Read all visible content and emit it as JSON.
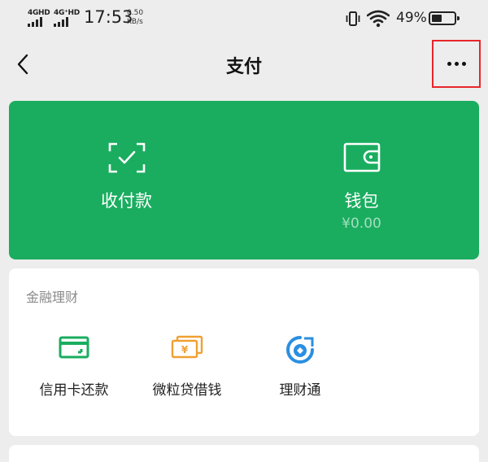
{
  "status_bar": {
    "sim1": "4GHD",
    "sim2": "4G⁺HD",
    "time": "17:53",
    "net_speed": "0.50",
    "net_unit": "KB/s",
    "battery": "49%"
  },
  "header": {
    "title": "支付"
  },
  "pay_card": {
    "color": "#1aad5f",
    "receive": {
      "label": "收付款",
      "icon": "scan-check-icon"
    },
    "wallet": {
      "label": "钱包",
      "balance": "¥0.00",
      "icon": "wallet-icon"
    }
  },
  "finance": {
    "title": "金融理财",
    "items": [
      {
        "label": "信用卡还款",
        "icon": "credit-card-icon",
        "color": "#1aad5f"
      },
      {
        "label": "微粒贷借钱",
        "icon": "banknote-icon",
        "color": "#f0a030"
      },
      {
        "label": "理财通",
        "icon": "licaitong-icon",
        "color": "#2b8fe0"
      }
    ]
  },
  "highlight_color": "#e8262a"
}
